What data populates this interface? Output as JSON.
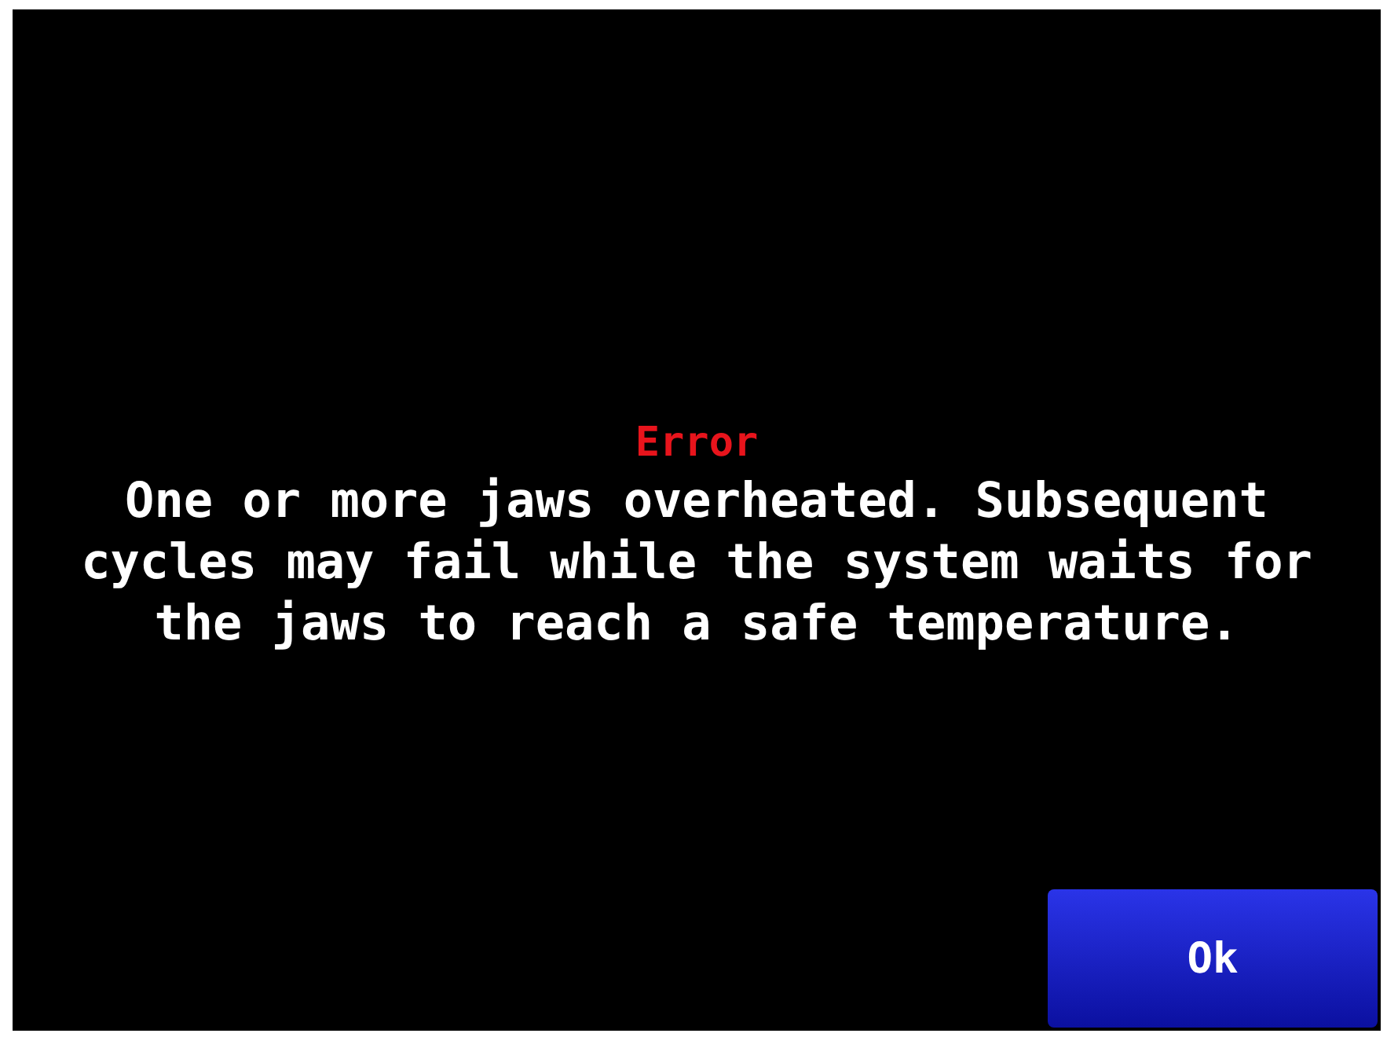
{
  "dialog": {
    "title": "Error",
    "message": "One or more jaws overheated. Subsequent cycles may fail while the system waits for the jaws to reach a safe temperature.",
    "buttons": [
      "Ok"
    ]
  }
}
